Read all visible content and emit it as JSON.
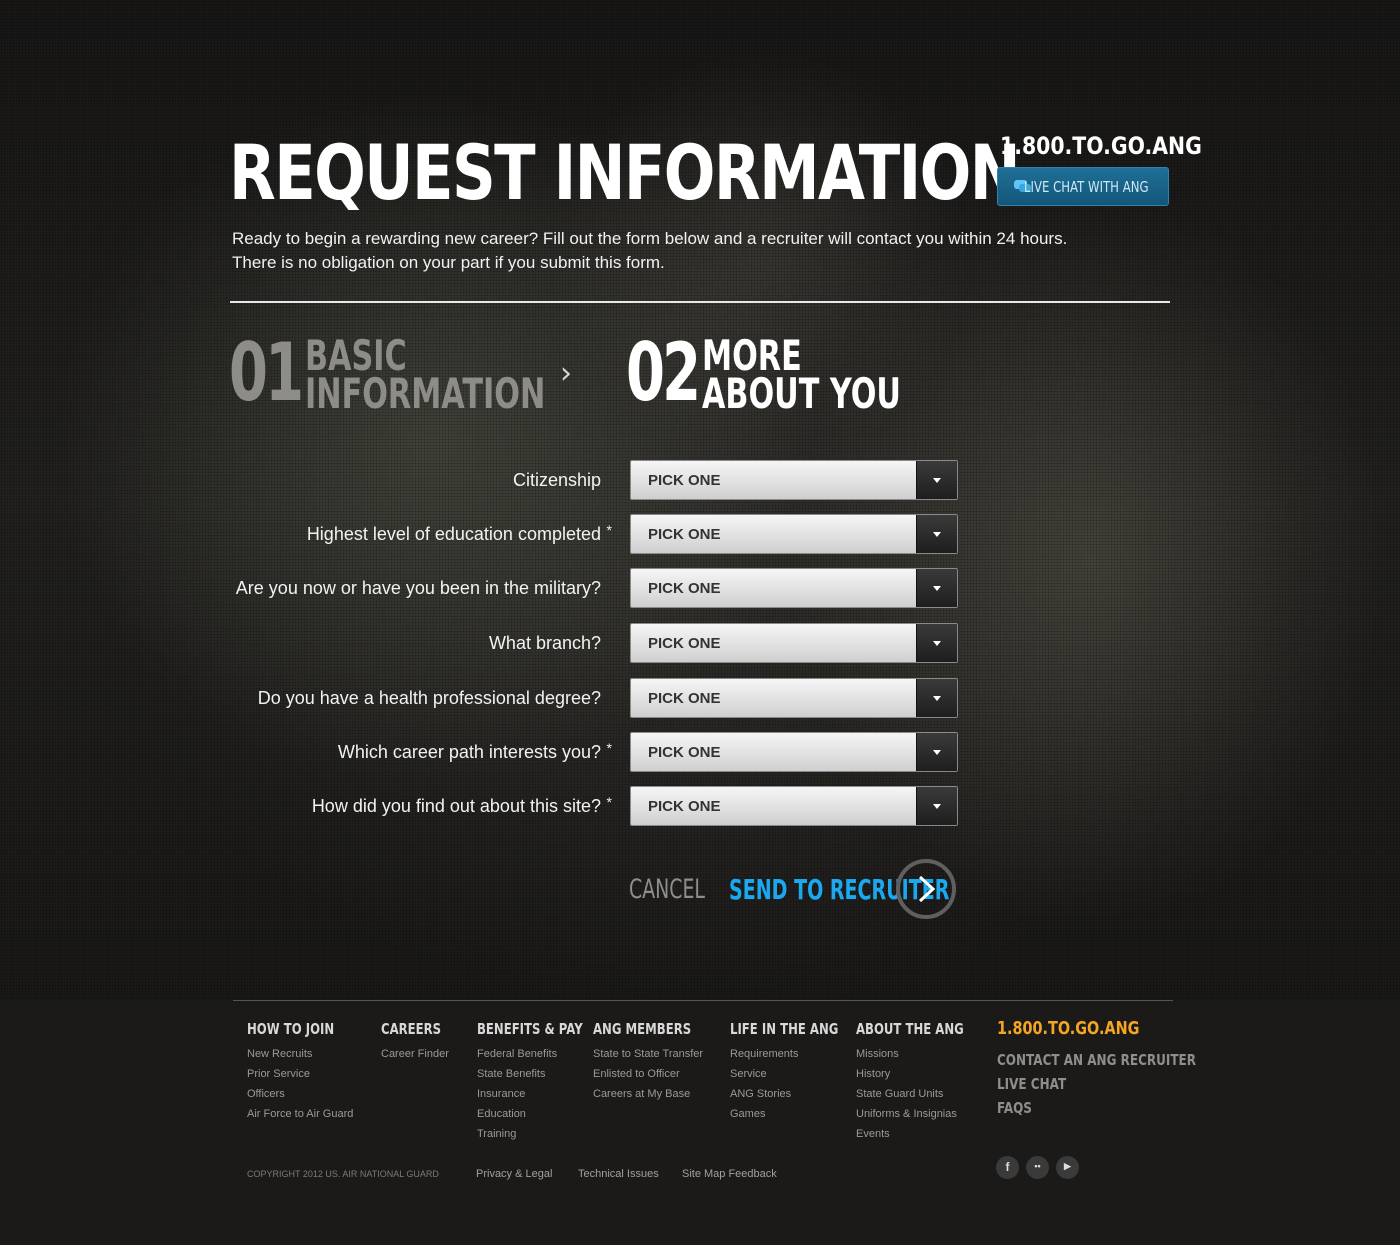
{
  "header": {
    "title": "REQUEST INFORMATION",
    "phone": "1.800.TO.GO.ANG",
    "live_chat_label": "LIVE CHAT WITH ANG",
    "intro_line1": "Ready to begin a rewarding new career? Fill out the form below and a recruiter will contact you within 24 hours.",
    "intro_line2": "There is no obligation on your part if you submit this form."
  },
  "steps": [
    {
      "number": "01",
      "line1": "BASIC",
      "line2": "INFORMATION",
      "state": "completed"
    },
    {
      "number": "02",
      "line1": "MORE",
      "line2": "ABOUT YOU",
      "state": "active"
    }
  ],
  "form": {
    "questions": [
      {
        "label": "Citizenship",
        "required": false,
        "value": "PICK ONE"
      },
      {
        "label": "Highest level of education completed",
        "required": true,
        "value": "PICK ONE"
      },
      {
        "label": "Are you now or have you been in the military?",
        "required": false,
        "value": "PICK ONE"
      },
      {
        "label": "What branch?",
        "required": false,
        "value": "PICK ONE"
      },
      {
        "label": "Do you have a health professional degree?",
        "required": false,
        "value": "PICK ONE"
      },
      {
        "label": "Which career path interests you?",
        "required": true,
        "value": "PICK ONE"
      },
      {
        "label": "How did you find out about this site?",
        "required": true,
        "value": "PICK ONE"
      }
    ],
    "required_marker": "*",
    "cancel_label": "CANCEL",
    "submit_label": "SEND TO RECRUITER"
  },
  "footer": {
    "columns": [
      {
        "heading": "HOW TO JOIN",
        "links": [
          "New Recruits",
          "Prior Service",
          "Officers",
          "Air Force to Air Guard"
        ]
      },
      {
        "heading": "CAREERS",
        "links": [
          "Career Finder"
        ]
      },
      {
        "heading": "BENEFITS & PAY",
        "links": [
          "Federal Benefits",
          "State Benefits",
          "Insurance",
          "Education",
          "Training"
        ]
      },
      {
        "heading": "ANG MEMBERS",
        "links": [
          "State to State Transfer",
          "Enlisted to Officer",
          "Careers at My Base"
        ]
      },
      {
        "heading": "LIFE IN THE ANG",
        "links": [
          "Requirements",
          "Service",
          "ANG Stories",
          "Games"
        ]
      },
      {
        "heading": "ABOUT THE ANG",
        "links": [
          "Missions",
          "History",
          "State Guard Units",
          "Uniforms & Insignias",
          "Events"
        ]
      }
    ],
    "phone": "1.800.TO.GO.ANG",
    "right_links": [
      "CONTACT AN ANG RECRUITER",
      "LIVE CHAT",
      "FAQS"
    ],
    "copyright": "COPYRIGHT 2012 US. AIR NATIONAL GUARD",
    "legal_links": [
      "Privacy & Legal",
      "Technical Issues",
      "Site Map Feedback"
    ],
    "social": [
      {
        "icon": "facebook-icon",
        "glyph": "f"
      },
      {
        "icon": "flickr-icon",
        "glyph": "••"
      },
      {
        "icon": "youtube-icon",
        "glyph": "▶"
      }
    ]
  },
  "colors": {
    "background": "#1b1a19",
    "accent_blue": "#1aa9f0",
    "live_chat_blue": "#1f6f97",
    "footer_phone": "#f5a623"
  }
}
